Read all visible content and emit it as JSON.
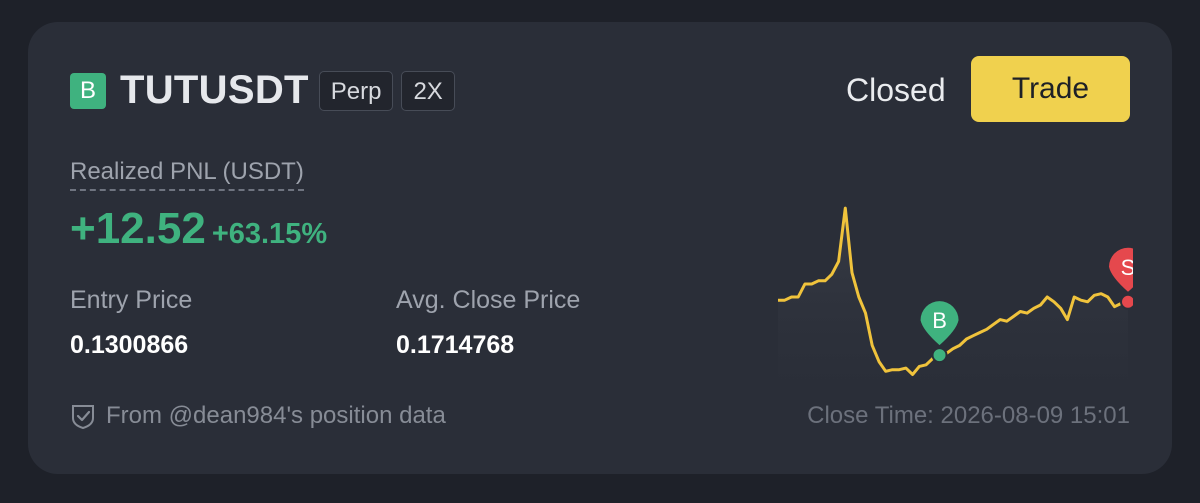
{
  "position": {
    "side_badge": "B",
    "symbol": "TUTUSDT",
    "contract_type": "Perp",
    "leverage": "2X",
    "status": "Closed",
    "trade_label": "Trade"
  },
  "pnl": {
    "label": "Realized PNL (USDT)",
    "value": "+12.52",
    "percent": "+63.15%"
  },
  "stats": {
    "entry_label": "Entry Price",
    "entry_value": "0.1300866",
    "close_label": "Avg. Close Price",
    "close_value": "0.1714768"
  },
  "footer": {
    "source": "From @dean984's position data",
    "close_time": "Close Time: 2026-08-09 15:01"
  },
  "chart_data": {
    "type": "line",
    "y": [
      0.148,
      0.148,
      0.15,
      0.15,
      0.158,
      0.158,
      0.16,
      0.16,
      0.164,
      0.172,
      0.205,
      0.165,
      0.15,
      0.14,
      0.12,
      0.11,
      0.104,
      0.105,
      0.105,
      0.106,
      0.102,
      0.107,
      0.108,
      0.112,
      0.114,
      0.115,
      0.118,
      0.12,
      0.124,
      0.126,
      0.128,
      0.13,
      0.133,
      0.136,
      0.135,
      0.138,
      0.141,
      0.14,
      0.143,
      0.145,
      0.15,
      0.147,
      0.143,
      0.136,
      0.15,
      0.148,
      0.147,
      0.151,
      0.152,
      0.15,
      0.144,
      0.146,
      0.147
    ],
    "buy_marker": {
      "index": 24,
      "label": "B"
    },
    "sell_marker": {
      "index": 52,
      "label": "S"
    },
    "line_color": "#f0c33c",
    "buy_color": "#3fb27f",
    "sell_color": "#e5484d"
  },
  "colors": {
    "positive": "#3fb27f",
    "accent": "#f0d14e",
    "card": "#2a2e38"
  }
}
